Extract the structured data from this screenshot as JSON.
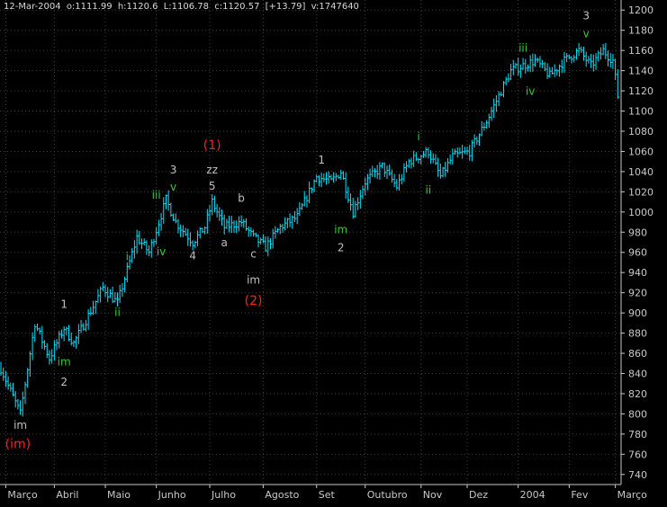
{
  "info": {
    "date": "12-Mar-2004",
    "open": "o:1111.99",
    "high": "h:1120.6",
    "low": "L:1106.78",
    "close": "c:1120.57",
    "change": "[+13.79]",
    "volume": "v:1747640"
  },
  "colors": {
    "background": "#000000",
    "price_bars": "#00e5ff",
    "grid": "#3f3f3f",
    "axis_text": "#c8c8c8",
    "primary_label": "#ff2020",
    "minor_label": "#33cc33",
    "intermediate_label": "#c0c0c0"
  },
  "chart_data": {
    "type": "line",
    "series_style": "ohlc-bars",
    "ylim": [
      730,
      1210
    ],
    "y_ticks": [
      740,
      760,
      780,
      800,
      820,
      840,
      860,
      880,
      900,
      920,
      940,
      960,
      980,
      1000,
      1020,
      1040,
      1060,
      1080,
      1100,
      1120,
      1140,
      1160,
      1180,
      1200
    ],
    "y_axis_side": "right",
    "grid": true,
    "x_ticks": [
      "Março",
      "Abril",
      "Maio",
      "Junho",
      "Julho",
      "Agosto",
      "Set",
      "Outubro",
      "Nov",
      "Dez",
      "2004",
      "Fev",
      "Março"
    ],
    "x_tick_positions": [
      2,
      22,
      43,
      64,
      86,
      108,
      130,
      150,
      173,
      192,
      213,
      234,
      253
    ],
    "price_anchors": [
      [
        0,
        845
      ],
      [
        8,
        800
      ],
      [
        14,
        890
      ],
      [
        20,
        855
      ],
      [
        26,
        885
      ],
      [
        30,
        870
      ],
      [
        42,
        925
      ],
      [
        48,
        910
      ],
      [
        56,
        975
      ],
      [
        61,
        960
      ],
      [
        68,
        1012
      ],
      [
        72,
        990
      ],
      [
        79,
        970
      ],
      [
        84,
        985
      ],
      [
        87,
        1010
      ],
      [
        92,
        985
      ],
      [
        99,
        990
      ],
      [
        104,
        975
      ],
      [
        109,
        965
      ],
      [
        115,
        985
      ],
      [
        122,
        995
      ],
      [
        130,
        1035
      ],
      [
        136,
        1030
      ],
      [
        140,
        1040
      ],
      [
        145,
        1000
      ],
      [
        150,
        1030
      ],
      [
        157,
        1045
      ],
      [
        163,
        1025
      ],
      [
        168,
        1050
      ],
      [
        176,
        1060
      ],
      [
        181,
        1035
      ],
      [
        186,
        1055
      ],
      [
        193,
        1060
      ],
      [
        200,
        1090
      ],
      [
        210,
        1140
      ],
      [
        220,
        1150
      ],
      [
        226,
        1135
      ],
      [
        232,
        1150
      ],
      [
        238,
        1160
      ],
      [
        243,
        1145
      ],
      [
        248,
        1160
      ],
      [
        252,
        1150
      ],
      [
        254,
        1115
      ]
    ],
    "annotations": [
      {
        "text": "(im)",
        "level": "primary",
        "x": 7,
        "y": 766
      },
      {
        "text": "im",
        "level": "intermediate",
        "x": 8,
        "y": 785
      },
      {
        "text": "1",
        "level": "intermediate",
        "x": 26,
        "y": 905
      },
      {
        "text": "im",
        "level": "minor",
        "x": 26,
        "y": 848
      },
      {
        "text": "2",
        "level": "intermediate",
        "x": 26,
        "y": 828
      },
      {
        "text": "i",
        "level": "minor",
        "x": 52,
        "y": 952
      },
      {
        "text": "ii",
        "level": "minor",
        "x": 48,
        "y": 897
      },
      {
        "text": "iii",
        "level": "minor",
        "x": 64,
        "y": 1013
      },
      {
        "text": "iv",
        "level": "minor",
        "x": 66,
        "y": 957
      },
      {
        "text": "v",
        "level": "minor",
        "x": 71,
        "y": 1021
      },
      {
        "text": "3",
        "level": "intermediate",
        "x": 71,
        "y": 1038
      },
      {
        "text": "4",
        "level": "intermediate",
        "x": 79,
        "y": 953
      },
      {
        "text": "(1)",
        "level": "primary",
        "x": 87,
        "y": 1062
      },
      {
        "text": "zz",
        "level": "intermediate",
        "x": 87,
        "y": 1038
      },
      {
        "text": "5",
        "level": "intermediate",
        "x": 87,
        "y": 1022
      },
      {
        "text": "a",
        "level": "intermediate",
        "x": 92,
        "y": 966
      },
      {
        "text": "b",
        "level": "intermediate",
        "x": 99,
        "y": 1010
      },
      {
        "text": "c",
        "level": "intermediate",
        "x": 104,
        "y": 955
      },
      {
        "text": "im",
        "level": "intermediate",
        "x": 104,
        "y": 929
      },
      {
        "text": "(2)",
        "level": "primary",
        "x": 104,
        "y": 908
      },
      {
        "text": "1",
        "level": "intermediate",
        "x": 132,
        "y": 1048
      },
      {
        "text": "im",
        "level": "minor",
        "x": 140,
        "y": 979
      },
      {
        "text": "2",
        "level": "intermediate",
        "x": 140,
        "y": 961
      },
      {
        "text": "i",
        "level": "minor",
        "x": 172,
        "y": 1071
      },
      {
        "text": "ii",
        "level": "minor",
        "x": 176,
        "y": 1018
      },
      {
        "text": "iii",
        "level": "minor",
        "x": 215,
        "y": 1159
      },
      {
        "text": "iv",
        "level": "minor",
        "x": 218,
        "y": 1116
      },
      {
        "text": "3",
        "level": "intermediate",
        "x": 241,
        "y": 1191
      },
      {
        "text": "v",
        "level": "minor",
        "x": 241,
        "y": 1173
      }
    ]
  }
}
